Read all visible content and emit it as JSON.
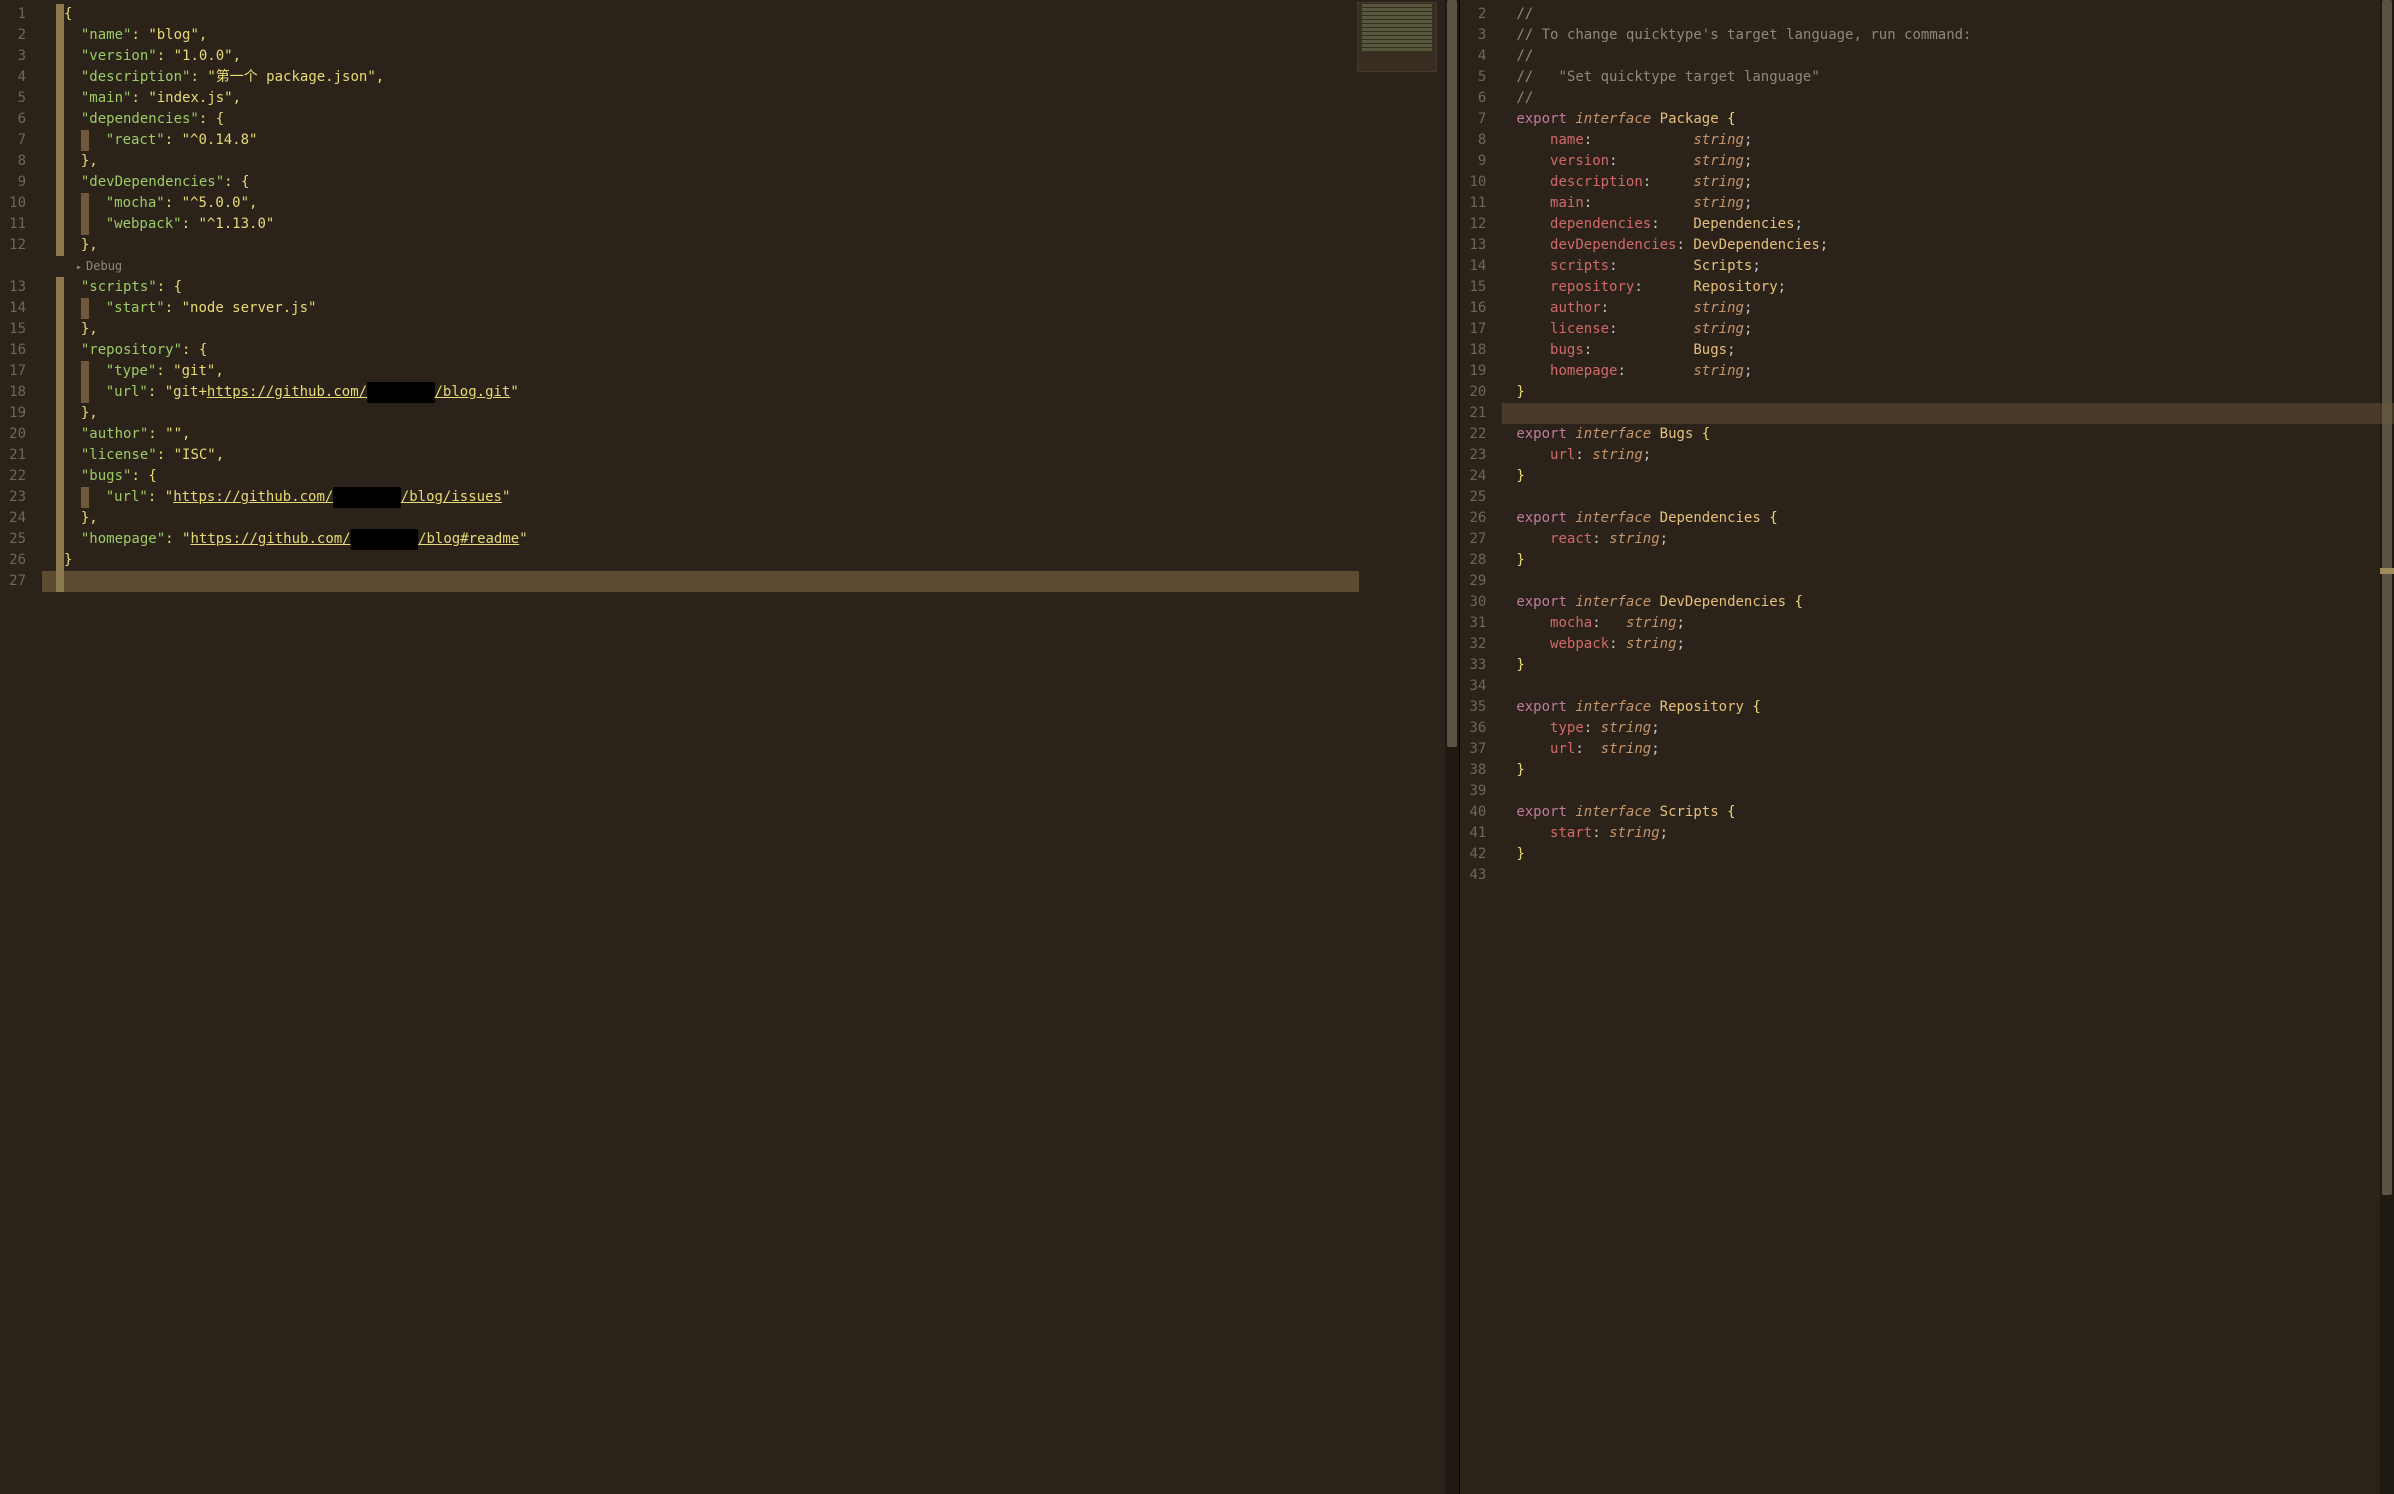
{
  "left": {
    "codelens": {
      "play": "▸",
      "label": "Debug"
    },
    "lines": {
      "l1_brace": "{",
      "l2_key": "\"name\"",
      "l2_val": "\"blog\"",
      "l3_key": "\"version\"",
      "l3_val": "\"1.0.0\"",
      "l4_key": "\"description\"",
      "l4_val": "\"第一个 package.json\"",
      "l5_key": "\"main\"",
      "l5_val": "\"index.js\"",
      "l6_key": "\"dependencies\"",
      "l6_brace": "{",
      "l7_key": "\"react\"",
      "l7_val": "\"^0.14.8\"",
      "l8_brace": "}",
      "l9_key": "\"devDependencies\"",
      "l9_brace": "{",
      "l10_key": "\"mocha\"",
      "l10_val": "\"^5.0.0\"",
      "l11_key": "\"webpack\"",
      "l11_val": "\"^1.13.0\"",
      "l12_brace": "}",
      "l13_key": "\"scripts\"",
      "l13_brace": "{",
      "l14_key": "\"start\"",
      "l14_val": "\"node server.js\"",
      "l15_brace": "}",
      "l16_key": "\"repository\"",
      "l16_brace": "{",
      "l17_key": "\"type\"",
      "l17_val": "\"git\"",
      "l18_key": "\"url\"",
      "l18_val_pre": "\"git+",
      "l18_url_a": "https://github.com/",
      "l18_url_b": "/blog.git",
      "l18_val_post": "\"",
      "l19_brace": "}",
      "l20_key": "\"author\"",
      "l20_val": "\"\"",
      "l21_key": "\"license\"",
      "l21_val": "\"ISC\"",
      "l22_key": "\"bugs\"",
      "l22_brace": "{",
      "l23_key": "\"url\"",
      "l23_val_pre": "\"",
      "l23_url_a": "https://github.com/",
      "l23_url_b": "/blog/issues",
      "l23_val_post": "\"",
      "l24_brace": "}",
      "l25_key": "\"homepage\"",
      "l25_val_pre": "\"",
      "l25_url_a": "https://github.com/",
      "l25_url_b": "/blog#readme",
      "l25_val_post": "\"",
      "l26_brace": "}"
    },
    "redacted": "████████"
  },
  "right": {
    "lines": {
      "c1": "//",
      "c2": "// To change quicktype's target language, run command:",
      "c3": "//",
      "c4": "//   \"Set quicktype target language\"",
      "c5": "//",
      "kw_export": "export",
      "kw_interface": "interface",
      "type_Package": "Package",
      "type_Bugs": "Bugs",
      "type_Dependencies": "Dependencies",
      "type_DevDependencies": "DevDependencies",
      "type_Repository": "Repository",
      "type_Scripts": "Scripts",
      "prim_string": "string",
      "p_name": "name",
      "p_version": "version",
      "p_description": "description",
      "p_main": "main",
      "p_dependencies": "dependencies",
      "p_devDependencies": "devDependencies",
      "p_scripts": "scripts",
      "p_repository": "repository",
      "p_author": "author",
      "p_license": "license",
      "p_bugs": "bugs",
      "p_homepage": "homepage",
      "p_url": "url",
      "p_react": "react",
      "p_mocha": "mocha",
      "p_webpack": "webpack",
      "p_type": "type",
      "p_start": "start",
      "brace_open": "{",
      "brace_close": "}",
      "semi": ";",
      "colon": ":"
    }
  }
}
